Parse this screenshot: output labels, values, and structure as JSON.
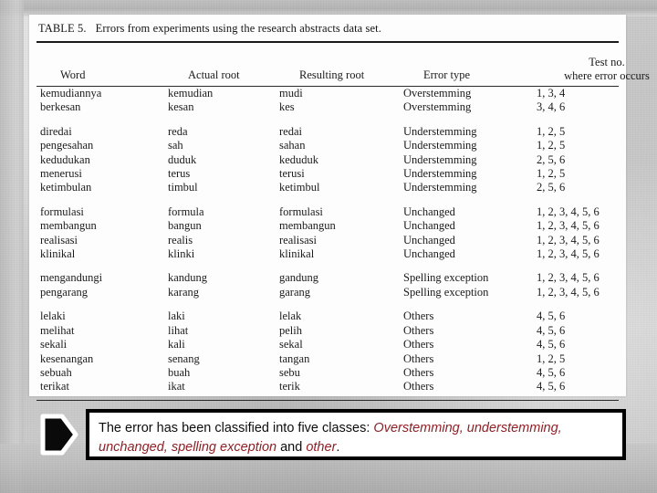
{
  "slide": {
    "background_color": "#c6c6c6",
    "sheet_color": "#fdfdfd"
  },
  "table": {
    "label": "TABLE 5.",
    "caption": "Errors from experiments using the research abstracts data set.",
    "columns": [
      "Word",
      "Actual root",
      "Resulting root",
      "Error type",
      "Test no.",
      "where error occurs"
    ],
    "groups": [
      {
        "error_type": "Overstemming",
        "rows": [
          {
            "word": "kemudiannya",
            "actual_root": "kemudian",
            "resulting_root": "mudi",
            "error_type": "Overstemming",
            "tests": "1, 3, 4"
          },
          {
            "word": "berkesan",
            "actual_root": "kesan",
            "resulting_root": "kes",
            "error_type": "Overstemming",
            "tests": "3, 4, 6"
          }
        ]
      },
      {
        "error_type": "Understemming",
        "rows": [
          {
            "word": "diredai",
            "actual_root": "reda",
            "resulting_root": "redai",
            "error_type": "Understemming",
            "tests": "1, 2, 5"
          },
          {
            "word": "pengesahan",
            "actual_root": "sah",
            "resulting_root": "sahan",
            "error_type": "Understemming",
            "tests": "1, 2, 5"
          },
          {
            "word": "kedudukan",
            "actual_root": "duduk",
            "resulting_root": "keduduk",
            "error_type": "Understemming",
            "tests": "2, 5, 6"
          },
          {
            "word": "menerusi",
            "actual_root": "terus",
            "resulting_root": "terusi",
            "error_type": "Understemming",
            "tests": "1, 2, 5"
          },
          {
            "word": "ketimbulan",
            "actual_root": "timbul",
            "resulting_root": "ketimbul",
            "error_type": "Understemming",
            "tests": "2, 5, 6"
          }
        ]
      },
      {
        "error_type": "Unchanged",
        "rows": [
          {
            "word": "formulasi",
            "actual_root": "formula",
            "resulting_root": "formulasi",
            "error_type": "Unchanged",
            "tests": "1, 2, 3, 4, 5, 6"
          },
          {
            "word": "membangun",
            "actual_root": "bangun",
            "resulting_root": "membangun",
            "error_type": "Unchanged",
            "tests": "1, 2, 3, 4, 5, 6"
          },
          {
            "word": "realisasi",
            "actual_root": "realis",
            "resulting_root": "realisasi",
            "error_type": "Unchanged",
            "tests": "1, 2, 3, 4, 5, 6"
          },
          {
            "word": "klinikal",
            "actual_root": "klinki",
            "resulting_root": "klinikal",
            "error_type": "Unchanged",
            "tests": "1, 2, 3, 4, 5, 6"
          }
        ]
      },
      {
        "error_type": "Spelling exception",
        "rows": [
          {
            "word": "mengandungi",
            "actual_root": "kandung",
            "resulting_root": "gandung",
            "error_type": "Spelling exception",
            "tests": "1, 2, 3, 4, 5, 6"
          },
          {
            "word": "pengarang",
            "actual_root": "karang",
            "resulting_root": "garang",
            "error_type": "Spelling exception",
            "tests": "1, 2, 3, 4, 5, 6"
          }
        ]
      },
      {
        "error_type": "Others",
        "rows": [
          {
            "word": "lelaki",
            "actual_root": "laki",
            "resulting_root": "lelak",
            "error_type": "Others",
            "tests": "4, 5, 6"
          },
          {
            "word": "melihat",
            "actual_root": "lihat",
            "resulting_root": "pelih",
            "error_type": "Others",
            "tests": "4, 5, 6"
          },
          {
            "word": "sekali",
            "actual_root": "kali",
            "resulting_root": "sekal",
            "error_type": "Others",
            "tests": "4, 5, 6"
          },
          {
            "word": "kesenangan",
            "actual_root": "senang",
            "resulting_root": "tangan",
            "error_type": "Others",
            "tests": "1, 2, 5"
          },
          {
            "word": "sebuah",
            "actual_root": "buah",
            "resulting_root": "sebu",
            "error_type": "Others",
            "tests": "4, 5, 6"
          },
          {
            "word": "terikat",
            "actual_root": "ikat",
            "resulting_root": "terik",
            "error_type": "Others",
            "tests": "4, 5, 6"
          }
        ]
      }
    ]
  },
  "callout": {
    "bullet_icon": "arrow-right-pentagon-icon",
    "highlight_color": "#8e2026",
    "segments": [
      {
        "text": "The error has been classified into five classes: ",
        "style": "plain"
      },
      {
        "text": "Overstemming, understemming, unchanged, spelling exception",
        "style": "highlight"
      },
      {
        "text": " and ",
        "style": "plain"
      },
      {
        "text": "other",
        "style": "highlight"
      },
      {
        "text": ".",
        "style": "plain"
      }
    ]
  }
}
